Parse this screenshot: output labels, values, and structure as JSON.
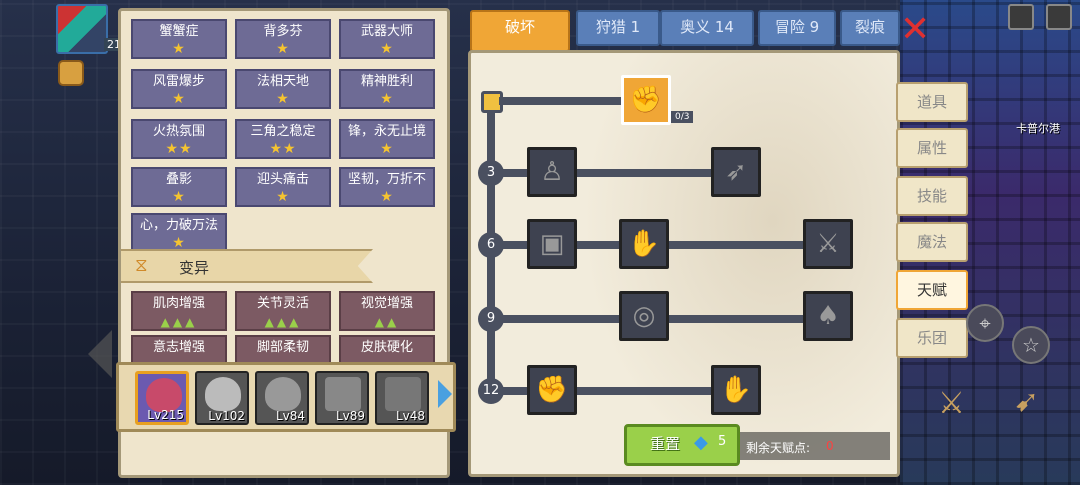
{
  "player": {
    "level": "21"
  },
  "skills": [
    {
      "label": "蟹蟹症",
      "stars": "★"
    },
    {
      "label": "背多芬",
      "stars": "★"
    },
    {
      "label": "武器大师",
      "stars": "★"
    },
    {
      "label": "风雷爆步",
      "stars": "★"
    },
    {
      "label": "法相天地",
      "stars": "★"
    },
    {
      "label": "精神胜利",
      "stars": "★"
    },
    {
      "label": "火热氛围",
      "stars": "★★"
    },
    {
      "label": "三角之稳定",
      "stars": "★★"
    },
    {
      "label": "锋，永无止境",
      "stars": "★"
    },
    {
      "label": "叠影",
      "stars": "★"
    },
    {
      "label": "迎头痛击",
      "stars": "★"
    },
    {
      "label": "坚韧，万折不",
      "stars": "★"
    },
    {
      "label": "心，力破万法",
      "stars": "★"
    }
  ],
  "section": {
    "title": "变异",
    "icon": "dna-icon"
  },
  "mutations": [
    {
      "label": "肌肉增强",
      "marks": "▲▲▲"
    },
    {
      "label": "关节灵活",
      "marks": "▲▲▲"
    },
    {
      "label": "视觉增强",
      "marks": "▲▲"
    },
    {
      "label": "意志增强",
      "marks": ""
    },
    {
      "label": "脚部柔韧",
      "marks": ""
    },
    {
      "label": "皮肤硬化",
      "marks": ""
    }
  ],
  "heroes": [
    {
      "level": "Lv215",
      "selected": true
    },
    {
      "level": "Lv102",
      "selected": false
    },
    {
      "level": "Lv84",
      "selected": false
    },
    {
      "level": "Lv89",
      "selected": false
    },
    {
      "level": "Lv48",
      "selected": false
    }
  ],
  "tabs": [
    {
      "label": "破坏",
      "active": true
    },
    {
      "label": "狩猎 1",
      "active": false
    },
    {
      "label": "奥义 14",
      "active": false
    },
    {
      "label": "冒险 9",
      "active": false
    },
    {
      "label": "裂痕",
      "active": false
    }
  ],
  "talent_tree": {
    "root_count": "0/3",
    "levels": [
      "3",
      "6",
      "9",
      "12"
    ]
  },
  "reset": {
    "label": "重置",
    "cost": "5"
  },
  "points": {
    "label": "剩余天赋点:",
    "value": "0"
  },
  "menu": [
    {
      "label": "道具",
      "active": false
    },
    {
      "label": "属性",
      "active": false
    },
    {
      "label": "技能",
      "active": false
    },
    {
      "label": "魔法",
      "active": false
    },
    {
      "label": "天赋",
      "active": true
    },
    {
      "label": "乐团",
      "active": false
    }
  ],
  "map": {
    "town_label": "卡普尔港"
  },
  "colors": {
    "accent": "#f0a636",
    "tab": "#5a7fb8",
    "reset": "#9ad04a",
    "points_value": "#ff4040"
  }
}
